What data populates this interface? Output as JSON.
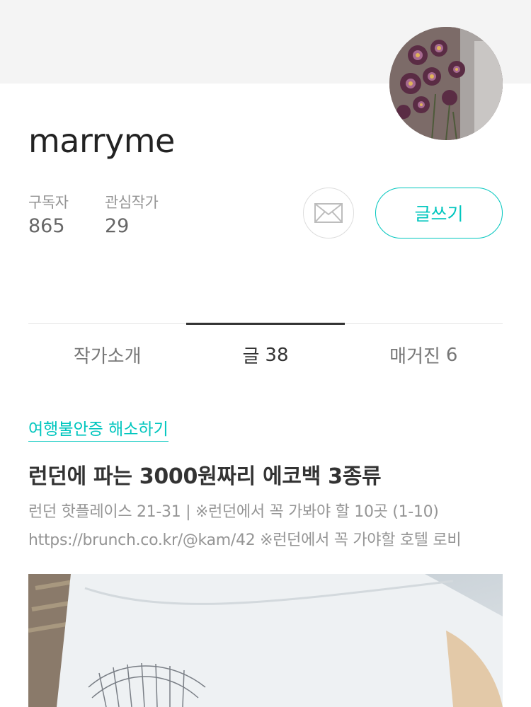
{
  "profile": {
    "author_name": "marryme",
    "avatar_icon": "flower-photo-avatar"
  },
  "stats": {
    "subscribers_label": "구독자",
    "subscribers_value": "865",
    "following_label": "관심작가",
    "following_value": "29"
  },
  "actions": {
    "message_icon": "envelope-icon",
    "write_label": "글쓰기"
  },
  "tabs": [
    {
      "label": "작가소개",
      "count": ""
    },
    {
      "label": "글",
      "count": "38"
    },
    {
      "label": "매거진",
      "count": "6"
    }
  ],
  "active_tab": "글",
  "post": {
    "magazine_tag": "여행불안증 해소하기",
    "title": "런던에 파는 3000원짜리 에코백 3종류",
    "excerpt_line1": "런던 핫플레이스 21-31 | ※런던에서 꼭 가봐야 할 10곳 (1-10)",
    "excerpt_line2": "https://brunch.co.kr/@kam/42 ※런던에서 꼭 가야할 호텔 로비",
    "image_icon": "eco-bag-photo"
  },
  "colors": {
    "accent": "#00c6be",
    "cover_background": "#f4f4f4",
    "text_primary": "#333333",
    "text_secondary": "#959595"
  }
}
